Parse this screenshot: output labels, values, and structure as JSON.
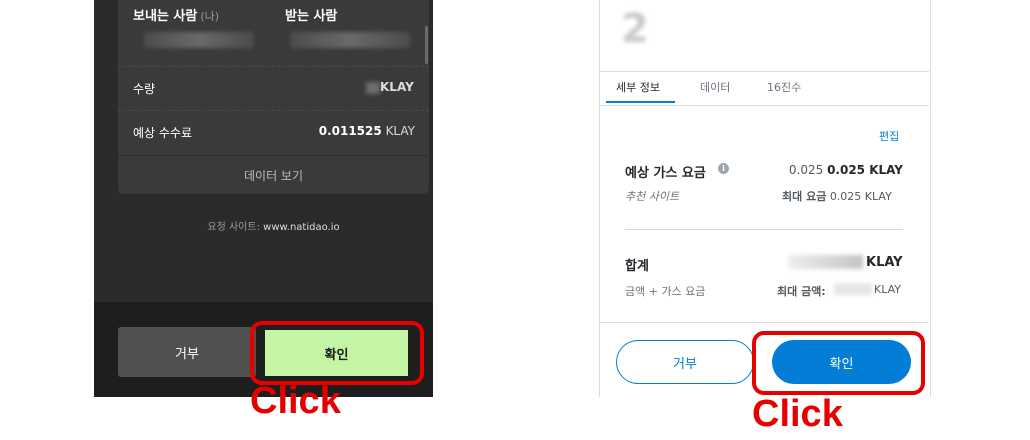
{
  "left": {
    "sender_label": "보내는 사람",
    "sender_me": "(나)",
    "receiver_label": "받는 사람",
    "amount_label": "수량",
    "amount_unit": "KLAY",
    "fee_label": "예상 수수료",
    "fee_value": "0.011525",
    "fee_unit": "KLAY",
    "view_data_label": "데이터 보기",
    "request_site_label": "요청 사이트:",
    "request_site_url": "www.natidao.io",
    "reject_label": "거부",
    "confirm_label": "확인",
    "click_annotation": "Click"
  },
  "right": {
    "tabs": [
      "세부 정보",
      "데이터",
      "16진수"
    ],
    "edit_label": "편집",
    "gas_label": "예상 가스 요금",
    "gas_value_secondary": "0.025",
    "gas_value_primary": "0.025 KLAY",
    "recommend_site_label": "추천 사이트",
    "max_fee_label": "최대 요금",
    "max_fee_value": "0.025 KLAY",
    "total_label": "합계",
    "total_unit": "KLAY",
    "total_sub_label": "금액 + 가스 요금",
    "max_amount_label": "최대 금액:",
    "max_amount_unit": "KLAY",
    "reject_label": "거부",
    "confirm_label": "확인",
    "click_annotation": "Click"
  },
  "colors": {
    "highlight": "#e60000",
    "left_confirm_bg": "#c4f5a4",
    "metamask_blue": "#037dd6"
  }
}
